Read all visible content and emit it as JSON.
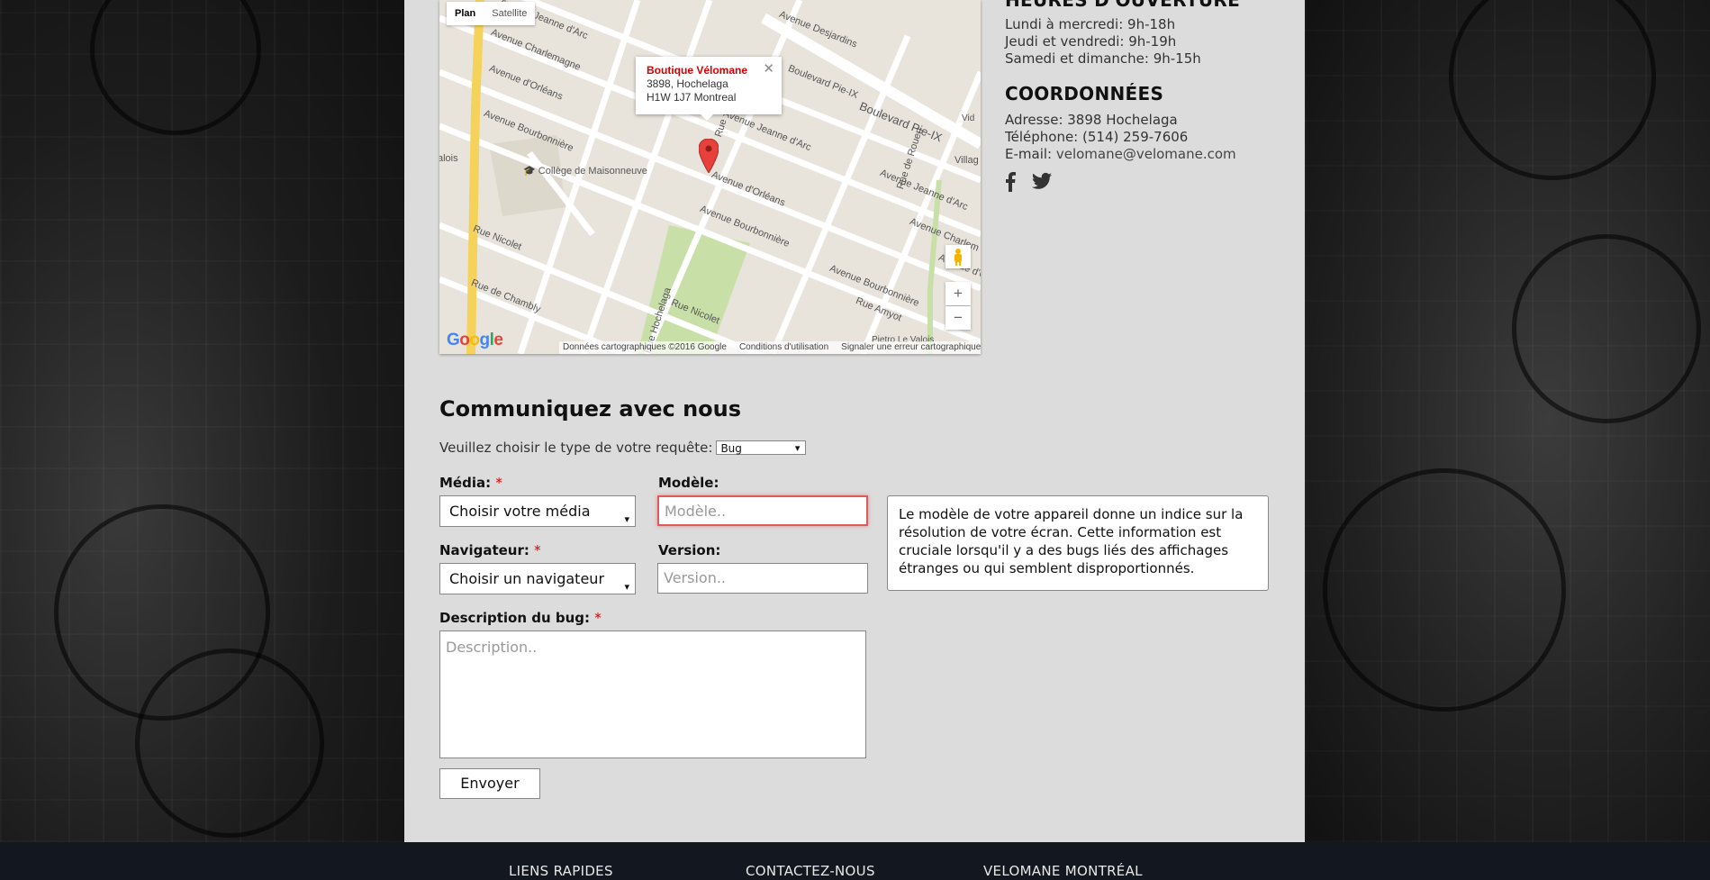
{
  "map": {
    "type_plan": "Plan",
    "type_satellite": "Satellite",
    "info_name": "Boutique Vélomane",
    "info_street": "3898, Hochelaga",
    "info_city": "H1W 1J7 Montreal",
    "close": "✕",
    "streets": {
      "jeanne_top": "Avenue Jeanne d'Arc",
      "charlemagne": "Avenue Charlemagne",
      "orleans": "Avenue d'Orléans",
      "bourbonniere": "Avenue Bourbonnière",
      "desjardins": "Avenue Desjardins",
      "pie_ix_top": "Boulevard Pie-IX",
      "pie_ix": "Boulevard Pie-IX",
      "jeanne": "Avenue Jeanne d'Arc",
      "rue": "Rue",
      "orleans2": "Avenue d'Orléans",
      "bourbonniere2": "Avenue Bourbonnière",
      "rouen": "Rue de Rouen",
      "jeanne2": "Avenue Jeanne d'Arc",
      "charlem2": "Avenue Charlem",
      "bourbonniere3": "Avenue Bourbonnière",
      "amyot": "Rue Amyot",
      "hochelaga": "Rue Hochelaga",
      "nicolet": "Rue Nicolet",
      "nicolet2": "Rue Nicolet",
      "chambly": "Rue de Chambly",
      "valois": "alois",
      "village": "Villag",
      "vid": "Vid",
      "orleans3": "Avenue d'O",
      "pietro": "Pietro Le Valois"
    },
    "campus": "Collège de Maisonneuve",
    "attribution": "Données cartographiques ©2016 Google",
    "terms": "Conditions d'utilisation",
    "report": "Signaler une erreur cartographique",
    "zoom_in": "+",
    "zoom_out": "−"
  },
  "hours": {
    "heading": "HEURES D'OUVERTURE",
    "lines": [
      "Lundi à mercredi: 9h-18h",
      "Jeudi et vendredi: 9h-19h",
      "Samedi et dimanche: 9h-15h"
    ]
  },
  "contact": {
    "heading": "COORDONNÉES",
    "address": "Adresse: 3898 Hochelaga",
    "phone": "Téléphone: (514) 259-7606",
    "email_label": "E-mail: ",
    "email": "velomane@velomane.com"
  },
  "form": {
    "title": "Communiquez avec nous",
    "request_label": "Veuillez choisir le type de votre requête:",
    "request_value": "Bug",
    "media_label": "Média:",
    "media_value": "Choisir votre média",
    "model_label": "Modèle:",
    "model_placeholder": "Modèle..",
    "browser_label": "Navigateur:",
    "browser_value": "Choisir un navigateur",
    "version_label": "Version:",
    "version_placeholder": "Version..",
    "tip": "Le modèle de votre appareil donne un indice sur la résolution de votre écran. Cette information est cruciale lorsqu'il y a des bugs liés des affichages étranges ou qui semblent disproportionnés.",
    "description_label": "Description du bug:",
    "description_placeholder": "Description..",
    "required_mark": "*",
    "submit": "Envoyer"
  },
  "footer": {
    "links": "LIENS RAPIDES",
    "contact": "CONTACTEZ-NOUS",
    "velomane": "VELOMANE MONTRÉAL"
  }
}
